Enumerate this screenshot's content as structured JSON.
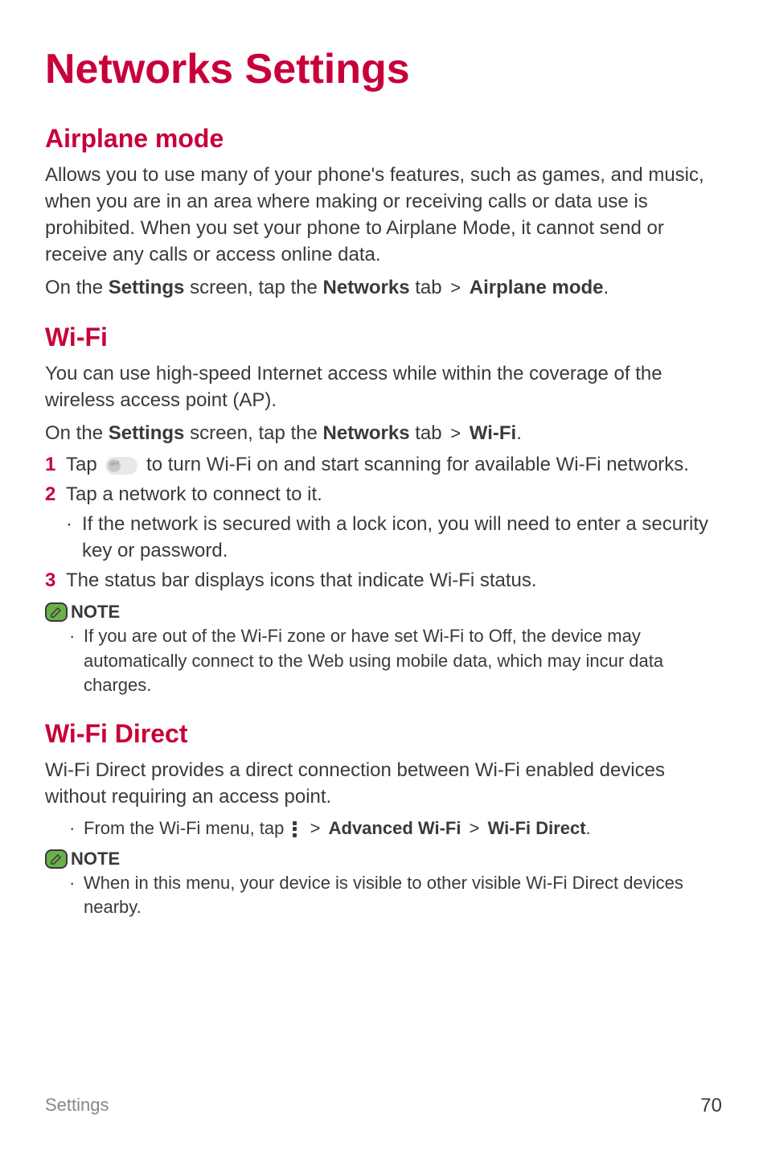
{
  "page": {
    "title": "Networks Settings"
  },
  "airplane": {
    "heading": "Airplane mode",
    "body": "Allows you to use many of your phone's features, such as games, and music, when you are in an area where making or receiving calls or data use is prohibited. When you set your phone to Airplane Mode, it cannot send or receive any calls or access online data.",
    "instruction_pre": "On the ",
    "instruction_settings": "Settings",
    "instruction_mid": " screen, tap the ",
    "instruction_networks": "Networks",
    "instruction_tab": " tab ",
    "instruction_target": "Airplane mode",
    "instruction_end": "."
  },
  "wifi": {
    "heading": "Wi-Fi",
    "body": "You can use high-speed Internet access while within the coverage of the wireless access point (AP).",
    "instruction_pre": "On the ",
    "instruction_settings": "Settings",
    "instruction_mid": " screen, tap the ",
    "instruction_networks": "Networks",
    "instruction_tab": " tab ",
    "instruction_target": "Wi-Fi",
    "instruction_end": ".",
    "steps": {
      "s1_num": "1",
      "s1_pre": "Tap ",
      "s1_post": " to turn Wi-Fi on and start scanning for available Wi-Fi networks.",
      "s2_num": "2",
      "s2_text": "Tap a network to connect to it.",
      "s2_sub": "If the network is secured with a lock icon, you will need to enter a security key or password.",
      "s3_num": "3",
      "s3_text": "The status bar displays icons that indicate Wi-Fi status."
    },
    "note": {
      "label": "NOTE",
      "text": "If you are out of the Wi-Fi zone or have set Wi-Fi to Off, the device may automatically connect to the Web using mobile data, which may incur data charges."
    }
  },
  "wifidirect": {
    "heading": "Wi-Fi Direct",
    "body": "Wi-Fi Direct provides a direct connection between Wi-Fi enabled devices without requiring an access point.",
    "bullet_pre": "From the Wi-Fi menu, tap ",
    "bullet_adv": "Advanced Wi-Fi",
    "bullet_target": "Wi-Fi Direct",
    "bullet_end": ".",
    "note": {
      "label": "NOTE",
      "text": "When in this menu, your device is visible to other visible Wi-Fi Direct devices nearby."
    }
  },
  "footer": {
    "section": "Settings",
    "page": "70"
  },
  "symbols": {
    "chevron": ">",
    "dot": "·"
  }
}
